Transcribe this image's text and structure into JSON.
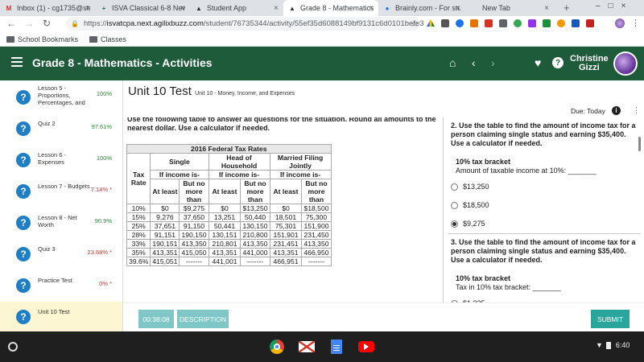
{
  "browser": {
    "tabs": [
      {
        "title": "Inbox (1) - cg1735@stu",
        "icon": "gmail-icon",
        "color": "#d93025",
        "glyph": "M",
        "active": false
      },
      {
        "title": "ISVA Classical 6-8 New",
        "icon": "sheets-icon",
        "color": "#188038",
        "glyph": "+",
        "active": false
      },
      {
        "title": "Student App",
        "icon": "agilix-icon",
        "color": "#333333",
        "glyph": "▲",
        "active": false
      },
      {
        "title": "Grade 8 - Mathematics -",
        "icon": "agilix-icon",
        "color": "#333333",
        "glyph": "▲",
        "active": true
      },
      {
        "title": "Brainly.com - For studen",
        "icon": "brainly-icon",
        "color": "#1a73e8",
        "glyph": "●",
        "active": false
      },
      {
        "title": "New Tab",
        "icon": "newtab-icon",
        "color": "#666666",
        "glyph": "",
        "active": false
      }
    ],
    "url_prefix": "https://",
    "url_host": "isvatcpa.next.agilixbuzz.com",
    "url_path": "/student/76735344/activity/55ef35d6088149bf9131c6d0101befe3",
    "bookmarks": [
      {
        "label": "School Bookmarks",
        "icon": "folder-icon"
      },
      {
        "label": "Classes",
        "icon": "folder-icon"
      }
    ],
    "apps_label": ""
  },
  "app": {
    "title": "Grade 8 - Mathematics - Activities",
    "user_first": "Christine",
    "user_last": "Gizzi",
    "accent": "#1e5b3a"
  },
  "sidebar": {
    "items": [
      {
        "label": "Lesson 5 - Proportions, Percentages, and",
        "score": "100%",
        "status": "green"
      },
      {
        "label": "Quiz 2",
        "score": "97.61%",
        "status": "green"
      },
      {
        "label": "Lesson 6 - Expenses",
        "score": "100%",
        "status": "green"
      },
      {
        "label": "Lesson 7 - Budgets",
        "score": "7.14% *",
        "status": "red"
      },
      {
        "label": "Lesson 8 - Net Worth",
        "score": "90.9%",
        "status": "green"
      },
      {
        "label": "Quiz 3",
        "score": "23.68% *",
        "status": "red"
      },
      {
        "label": "Practice Test",
        "score": "0% *",
        "status": "red"
      },
      {
        "label": "Unit 10 Test",
        "score": "",
        "status": "current"
      }
    ]
  },
  "main": {
    "unit_title": "Unit 10 Test",
    "unit_subtitle": "Unit 10 - Money, Income, and Expenses",
    "due": "Due: Today",
    "instruction": "Use the following table to answer all questions for the situation.  Round all amounts to the nearest dollar. Use a calculator if needed.",
    "table": {
      "caption": "2016 Federal Tax Rates",
      "tax_rate_header": "Tax Rate",
      "groups": [
        "Single",
        "Head of Household",
        "Married Filing Jointly"
      ],
      "if_income": "If income is-",
      "at_least": "At least",
      "no_more": "But no more than",
      "rows": [
        [
          "10%",
          "$0",
          "$9,275",
          "$0",
          "$13,250",
          "$0",
          "$18,500"
        ],
        [
          "15%",
          "9,276",
          "37,650",
          "13,251",
          "50,440",
          "18,501",
          "75,300"
        ],
        [
          "25%",
          "37,651",
          "91,150",
          "50,441",
          "130,150",
          "75,301",
          "151,900"
        ],
        [
          "28%",
          "91,151",
          "190,150",
          "130,151",
          "210,800",
          "151,901",
          "231,450"
        ],
        [
          "33%",
          "190,151",
          "413,350",
          "210,801",
          "413,350",
          "231,451",
          "413,350"
        ],
        [
          "35%",
          "413,351",
          "415,050",
          "413,351",
          "441,000",
          "413,351",
          "466,950"
        ],
        [
          "39.6%",
          "415,051",
          "-------",
          "441,001",
          "-------",
          "466,951",
          "-------"
        ]
      ]
    },
    "questions": [
      {
        "number": "2.",
        "text": "Use the table to find the amount of income tax for a person claiming single status and earning $35,400. Use a calculator if needed.",
        "sub": "10% tax bracket",
        "prompt": "Amount of taxable income at 10%: _______",
        "options": [
          {
            "label": "$13,250",
            "selected": false
          },
          {
            "label": "$18,500",
            "selected": false
          },
          {
            "label": "$9,275",
            "selected": true
          }
        ]
      },
      {
        "number": "3.",
        "text": "Use the table to find the amount of income tax for a person claiming single status and earning $35,400. Use a calculator if needed.",
        "sub": "10% tax bracket",
        "prompt": "Tax in 10% tax bracket: _______",
        "options": [
          {
            "label": "$1,325",
            "selected": false
          }
        ]
      }
    ],
    "timer": "00:38:08",
    "description_label": "DESCRIPTION",
    "submit_label": "SUBMIT"
  },
  "taskbar": {
    "apps": [
      {
        "name": "chrome-icon"
      },
      {
        "name": "gmail-icon"
      },
      {
        "name": "docs-icon"
      },
      {
        "name": "youtube-icon"
      }
    ],
    "time": "6:40"
  }
}
